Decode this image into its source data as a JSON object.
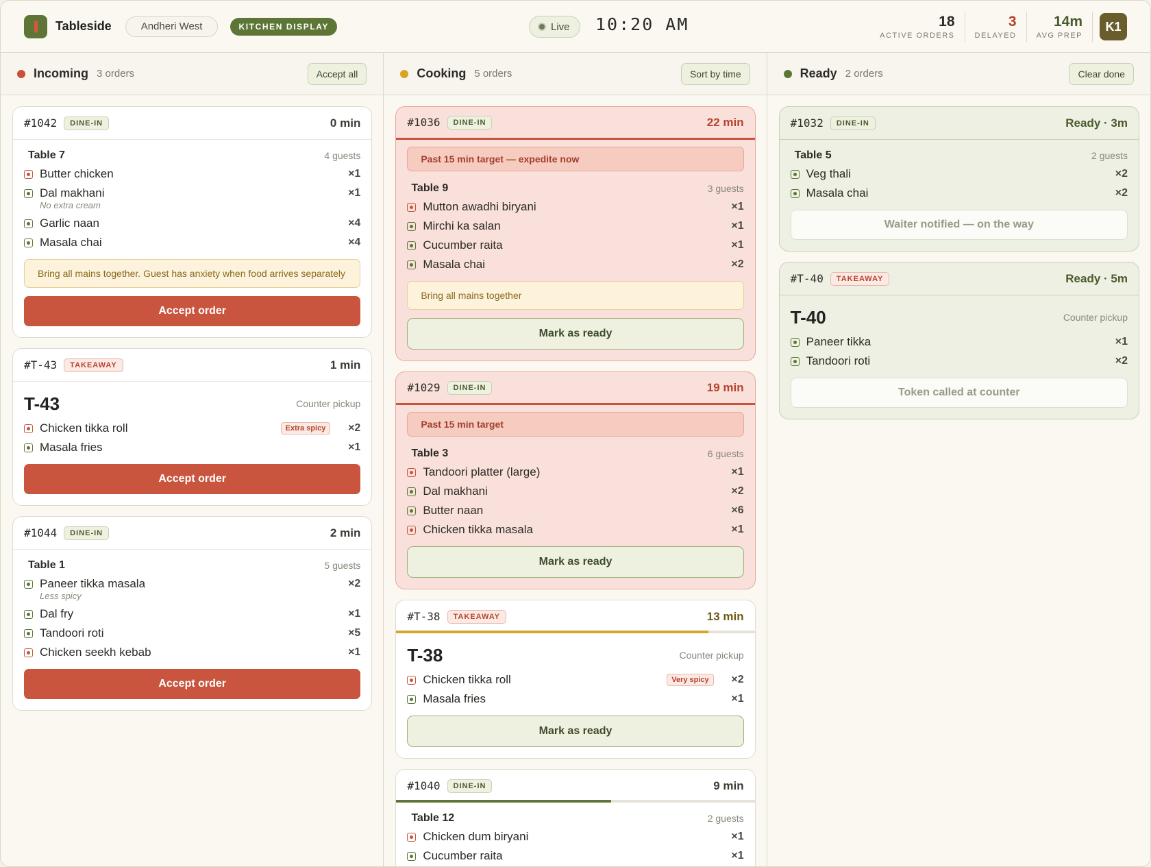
{
  "header": {
    "brand": "Tableside",
    "location": "Andheri West",
    "mode": "KITCHEN DISPLAY",
    "live": "Live",
    "clock": "10:20 AM",
    "stats": [
      {
        "value": "18",
        "label": "ACTIVE ORDERS"
      },
      {
        "value": "3",
        "label": "DELAYED"
      },
      {
        "value": "14m",
        "label": "AVG PREP"
      }
    ],
    "avatar": "K1"
  },
  "columns": {
    "incoming": {
      "title": "Incoming",
      "count": "3 orders",
      "action": "Accept all",
      "orders": [
        {
          "id": "#1042",
          "type": "DINE-IN",
          "time": "0 min",
          "table": "Table 7",
          "guests": "4 guests",
          "items": [
            {
              "name": "Butter chicken",
              "qty": "×1",
              "veg": false
            },
            {
              "name": "Dal makhani",
              "qty": "×1",
              "veg": true,
              "note": "No extra cream"
            },
            {
              "name": "Garlic naan",
              "qty": "×4",
              "veg": true
            },
            {
              "name": "Masala chai",
              "qty": "×4",
              "veg": true
            }
          ],
          "memo": "Bring all mains together. Guest has anxiety when food arrives separately",
          "action": "Accept order"
        },
        {
          "id": "#T-43",
          "type": "TAKEAWAY",
          "time": "1 min",
          "token": "T-43",
          "pickup": "Counter pickup",
          "items": [
            {
              "name": "Chicken tikka roll",
              "qty": "×2",
              "veg": false,
              "mod": "Extra spicy"
            },
            {
              "name": "Masala fries",
              "qty": "×1",
              "veg": true
            }
          ],
          "action": "Accept order"
        },
        {
          "id": "#1044",
          "type": "DINE-IN",
          "time": "2 min",
          "table": "Table 1",
          "guests": "5 guests",
          "items": [
            {
              "name": "Paneer tikka masala",
              "qty": "×2",
              "veg": true,
              "note": "Less spicy"
            },
            {
              "name": "Dal fry",
              "qty": "×1",
              "veg": true
            },
            {
              "name": "Tandoori roti",
              "qty": "×5",
              "veg": true
            },
            {
              "name": "Chicken seekh kebab",
              "qty": "×1",
              "veg": false
            }
          ],
          "action": "Accept order"
        }
      ]
    },
    "cooking": {
      "title": "Cooking",
      "count": "5 orders",
      "action": "Sort by time",
      "orders": [
        {
          "id": "#1036",
          "type": "DINE-IN",
          "time": "22 min",
          "warning": "Past 15 min target — expedite now",
          "table": "Table 9",
          "guests": "3 guests",
          "items": [
            {
              "name": "Mutton awadhi biryani",
              "qty": "×1",
              "veg": false
            },
            {
              "name": "Mirchi ka salan",
              "qty": "×1",
              "veg": true
            },
            {
              "name": "Cucumber raita",
              "qty": "×1",
              "veg": true
            },
            {
              "name": "Masala chai",
              "qty": "×2",
              "veg": true
            }
          ],
          "memo": "Bring all mains together",
          "action": "Mark as ready"
        },
        {
          "id": "#1029",
          "type": "DINE-IN",
          "time": "19 min",
          "warning": "Past 15 min target",
          "table": "Table 3",
          "guests": "6 guests",
          "items": [
            {
              "name": "Tandoori platter (large)",
              "qty": "×1",
              "veg": false
            },
            {
              "name": "Dal makhani",
              "qty": "×2",
              "veg": true
            },
            {
              "name": "Butter naan",
              "qty": "×6",
              "veg": true
            },
            {
              "name": "Chicken tikka masala",
              "qty": "×1",
              "veg": false
            }
          ],
          "action": "Mark as ready"
        },
        {
          "id": "#T-38",
          "type": "TAKEAWAY",
          "time": "13 min",
          "progress": 0.87,
          "progress_color": "#d3a62a",
          "token": "T-38",
          "pickup": "Counter pickup",
          "items": [
            {
              "name": "Chicken tikka roll",
              "qty": "×2",
              "veg": false,
              "mod": "Very spicy"
            },
            {
              "name": "Masala fries",
              "qty": "×1",
              "veg": true
            }
          ],
          "action": "Mark as ready"
        },
        {
          "id": "#1040",
          "type": "DINE-IN",
          "time": "9 min",
          "progress": 0.6,
          "progress_color": "#5d7636",
          "table": "Table 12",
          "guests": "2 guests",
          "items": [
            {
              "name": "Chicken dum biryani",
              "qty": "×1",
              "veg": false
            },
            {
              "name": "Cucumber raita",
              "qty": "×1",
              "veg": true
            }
          ]
        }
      ]
    },
    "ready": {
      "title": "Ready",
      "count": "2 orders",
      "action": "Clear done",
      "orders": [
        {
          "id": "#1032",
          "type": "DINE-IN",
          "time": "Ready · 3m",
          "table": "Table 5",
          "guests": "2 guests",
          "items": [
            {
              "name": "Veg thali",
              "qty": "×2",
              "veg": true
            },
            {
              "name": "Masala chai",
              "qty": "×2",
              "veg": true
            }
          ],
          "status": "Waiter notified — on the way"
        },
        {
          "id": "#T-40",
          "type": "TAKEAWAY",
          "time": "Ready · 5m",
          "token": "T-40",
          "pickup": "Counter pickup",
          "items": [
            {
              "name": "Paneer tikka",
              "qty": "×1",
              "veg": true
            },
            {
              "name": "Tandoori roti",
              "qty": "×2",
              "veg": true
            }
          ],
          "status": "Token called at counter"
        }
      ]
    }
  },
  "colors": {
    "incoming": "#c9503a",
    "cooking": "#d9a423",
    "ready": "#5d7636"
  }
}
